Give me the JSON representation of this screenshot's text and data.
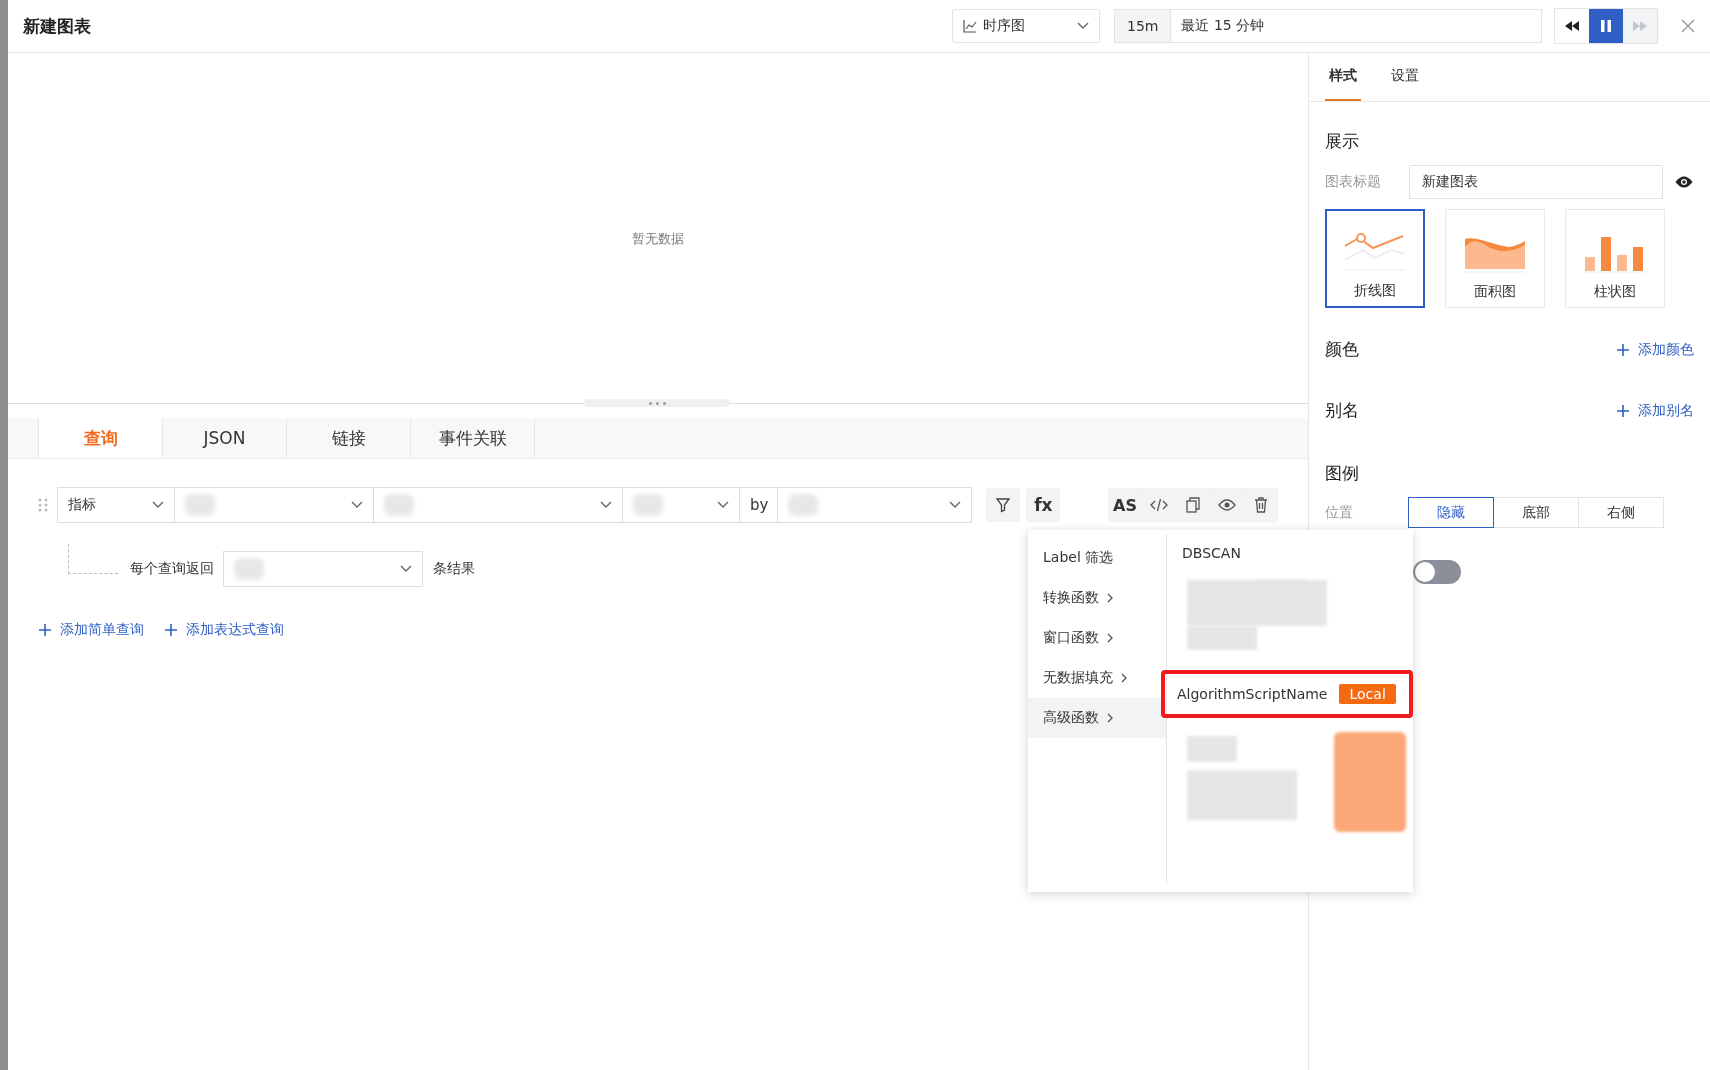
{
  "header": {
    "title": "新建图表",
    "chart_type": "时序图",
    "time_short": "15m",
    "time_range": "最近 15 分钟",
    "controls": [
      {
        "kind": "rewind",
        "selected": false,
        "disabled": false
      },
      {
        "kind": "pause",
        "selected": true,
        "disabled": false
      },
      {
        "kind": "forward",
        "selected": false,
        "disabled": true
      }
    ]
  },
  "preview": {
    "empty_text": "暂无数据"
  },
  "query_tabs": [
    {
      "label": "查询",
      "selected": true
    },
    {
      "label": "JSON",
      "selected": false
    },
    {
      "label": "链接",
      "selected": false
    },
    {
      "label": "事件关联",
      "selected": false
    }
  ],
  "query": {
    "metric_type": "指标",
    "by_label": "by",
    "return_label": "每个查询返回",
    "result_label": "条结果",
    "fx_label": "fx",
    "as_label": "AS"
  },
  "add_links": [
    "添加简单查询",
    "添加表达式查询"
  ],
  "function_menu": {
    "categories": [
      {
        "label": "Label 筛选",
        "has_submenu": false,
        "selected": false
      },
      {
        "label": "转换函数",
        "has_submenu": true,
        "selected": false
      },
      {
        "label": "窗口函数",
        "has_submenu": true,
        "selected": false
      },
      {
        "label": "无数据填充",
        "has_submenu": true,
        "selected": false
      },
      {
        "label": "高级函数",
        "has_submenu": true,
        "selected": true
      }
    ],
    "items": [
      {
        "kind": "text",
        "label": "DBSCAN"
      },
      {
        "kind": "redacted"
      },
      {
        "kind": "highlighted",
        "label": "AlgorithmScriptName",
        "badge": "Local"
      },
      {
        "kind": "redacted_badge"
      }
    ]
  },
  "settings": {
    "tabs": [
      {
        "label": "样式",
        "selected": true
      },
      {
        "label": "设置",
        "selected": false
      }
    ],
    "display_heading": "展示",
    "title_label": "图表标题",
    "title_value": "新建图表",
    "chart_types": [
      {
        "kind": "line",
        "label": "折线图",
        "selected": true
      },
      {
        "kind": "area",
        "label": "面积图",
        "selected": false
      },
      {
        "kind": "bar",
        "label": "柱状图",
        "selected": false
      }
    ],
    "sections": [
      {
        "heading": "颜色",
        "action": "添加颜色"
      },
      {
        "heading": "别名",
        "action": "添加别名"
      }
    ],
    "legend_heading": "图例",
    "position_label": "位置",
    "positions": [
      {
        "label": "隐藏",
        "selected": true
      },
      {
        "label": "底部",
        "selected": false
      },
      {
        "label": "右侧",
        "selected": false
      }
    ],
    "toggle": {
      "on": false
    }
  }
}
